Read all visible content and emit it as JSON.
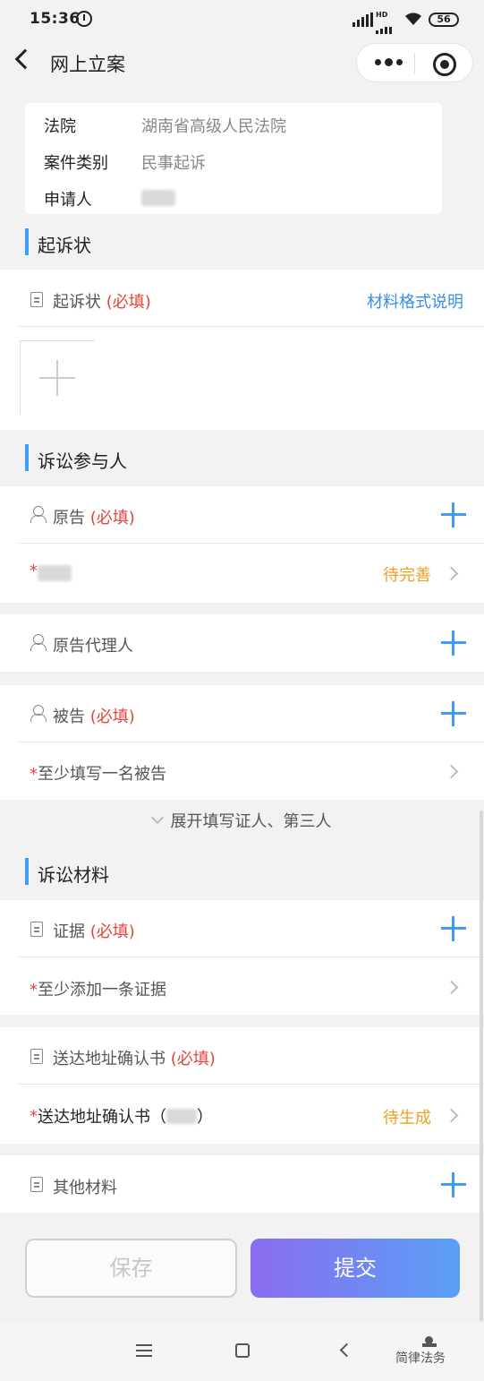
{
  "status_bar": {
    "time": "15:36",
    "battery": "56",
    "hd": "HD"
  },
  "nav": {
    "title": "网上立案"
  },
  "info": {
    "rows": [
      {
        "label": "法院",
        "value": "湖南省高级人民法院"
      },
      {
        "label": "案件类别",
        "value": "民事起诉"
      },
      {
        "label": "申请人",
        "value": ""
      }
    ]
  },
  "complaint": {
    "section_title": "起诉状",
    "item_label": "起诉状",
    "required": "(必填)",
    "format_link": "材料格式说明"
  },
  "participants": {
    "section_title": "诉讼参与人",
    "plaintiff": {
      "label": "原告",
      "required": "(必填)",
      "entry_star": "*",
      "entry_status": "待完善"
    },
    "plaintiff_agent": {
      "label": "原告代理人"
    },
    "defendant": {
      "label": "被告",
      "required": "(必填)",
      "entry_star": "*",
      "entry_text": "至少填写一名被告"
    },
    "expand_text": "展开填写证人、第三人"
  },
  "materials": {
    "section_title": "诉讼材料",
    "evidence": {
      "label": "证据",
      "required": "(必填)",
      "entry_star": "*",
      "entry_text": "至少添加一条证据"
    },
    "address_confirm": {
      "label": "送达地址确认书",
      "required": "(必填)",
      "entry_star": "*",
      "entry_text_prefix": "送达地址确认书（",
      "entry_text_suffix": "）",
      "entry_status": "待生成"
    },
    "other": {
      "label": "其他材料"
    }
  },
  "buttons": {
    "save": "保存",
    "submit": "提交"
  },
  "watermark": "简律法务",
  "colors": {
    "accent": "#3f9bff",
    "required": "#e0463a",
    "pending": "#f0a020",
    "link": "#3a8ee6"
  }
}
